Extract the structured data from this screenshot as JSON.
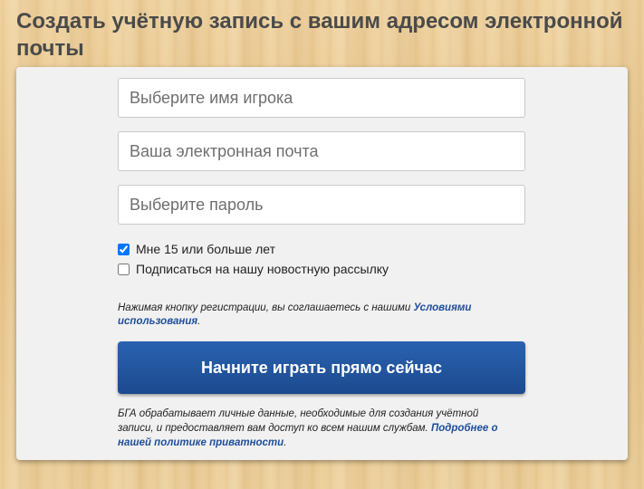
{
  "page": {
    "title": "Создать учётную запись с вашим адресом электронной почты"
  },
  "form": {
    "player_name": {
      "placeholder": "Выберите имя игрока",
      "value": ""
    },
    "email": {
      "placeholder": "Ваша электронная почта",
      "value": ""
    },
    "password": {
      "placeholder": "Выберите пароль",
      "value": ""
    },
    "age_checkbox": {
      "label": "Мне 15 или больше лет",
      "checked": true
    },
    "newsletter_checkbox": {
      "label": "Подписаться на нашу новостную рассылку",
      "checked": false
    },
    "terms_text": "Нажимая кнопку регистрации, вы соглашаетесь с нашими",
    "terms_link": "Условиями использования",
    "terms_end": ".",
    "submit_label": "Начните играть прямо сейчас",
    "privacy_text": "БГА обрабатывает личные данные, необходимые для создания учётной записи, и предоставляет вам доступ ко всем нашим службам.",
    "privacy_link": "Подробнее о нашей политике приватности",
    "privacy_end": "."
  },
  "colors": {
    "button": "#1f4f9a",
    "link": "#1f4f9a",
    "title": "#4a4a4a",
    "panel": "#f1f1f1"
  }
}
